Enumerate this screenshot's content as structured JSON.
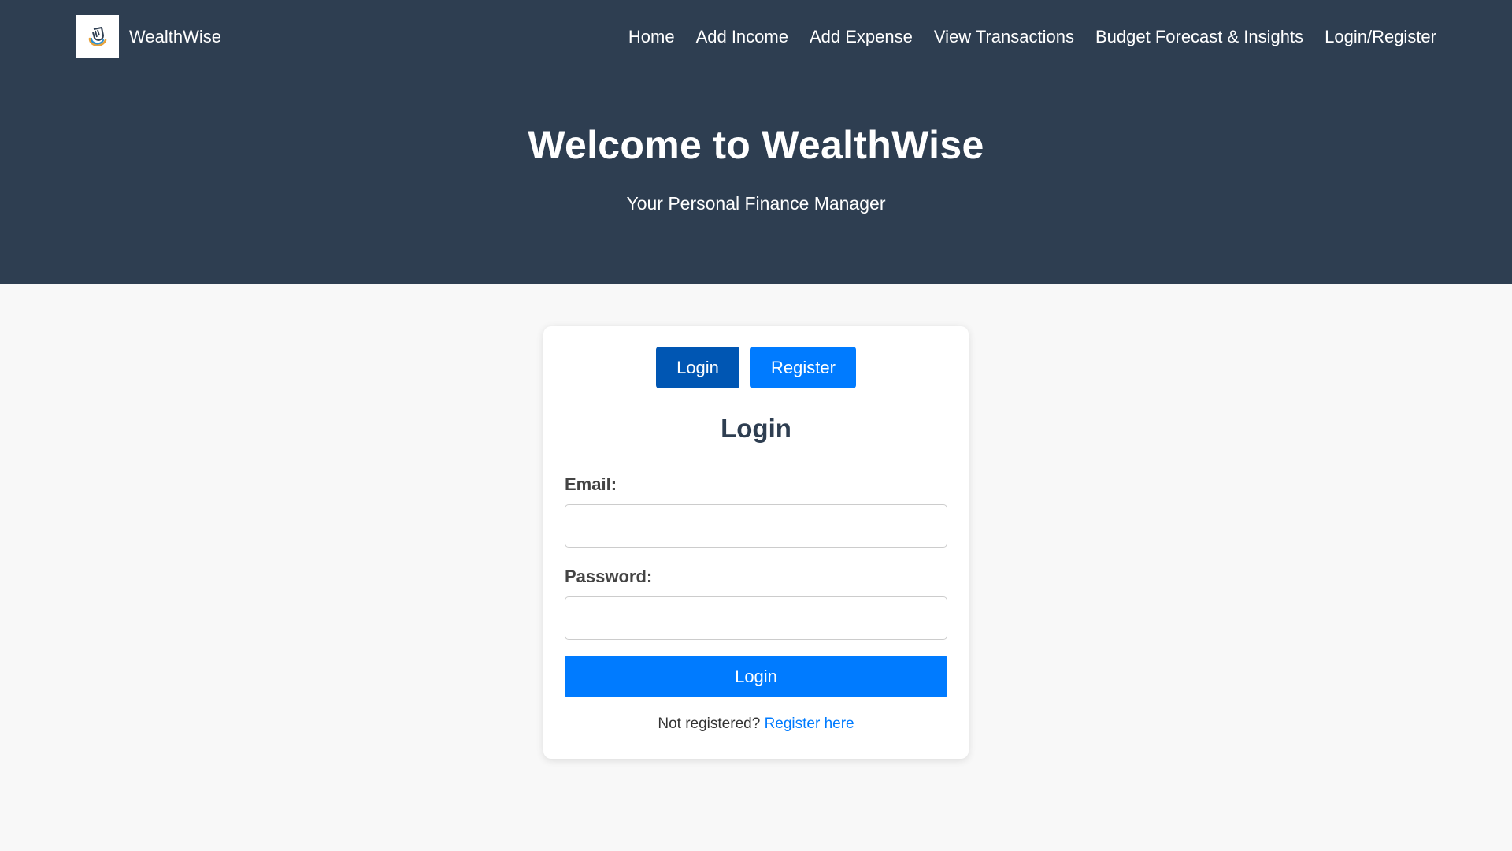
{
  "header": {
    "brand_name": "WealthWise",
    "logo_icon": "wallet-hand-icon",
    "nav": [
      {
        "label": "Home"
      },
      {
        "label": "Add Income"
      },
      {
        "label": "Add Expense"
      },
      {
        "label": "View Transactions"
      },
      {
        "label": "Budget Forecast & Insights"
      },
      {
        "label": "Login/Register"
      }
    ]
  },
  "hero": {
    "title": "Welcome to WealthWise",
    "subtitle": "Your Personal Finance Manager"
  },
  "auth": {
    "toggle": {
      "login_label": "Login",
      "register_label": "Register",
      "active": "login"
    },
    "form_title": "Login",
    "email": {
      "label": "Email:",
      "value": "",
      "placeholder": ""
    },
    "password": {
      "label": "Password:",
      "value": "",
      "placeholder": ""
    },
    "submit_label": "Login",
    "switch_prompt": "Not registered?",
    "switch_link": "Register here"
  },
  "colors": {
    "header_bg": "#2e3e51",
    "page_bg": "#f8f8f8",
    "primary": "#007bff",
    "primary_active": "#0056b3"
  }
}
